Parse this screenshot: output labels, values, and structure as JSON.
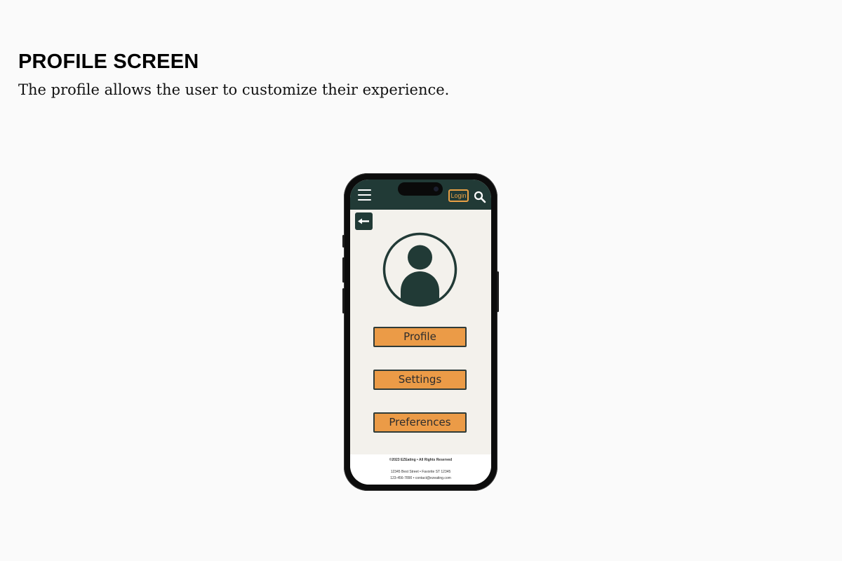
{
  "page": {
    "title": "PROFILE SCREEN",
    "description": "The profile allows the user to customize their experience."
  },
  "app": {
    "topbar": {
      "menu_icon": "hamburger-menu-icon",
      "login_label": "Login",
      "search_icon": "search-icon"
    },
    "back_icon": "arrow-left-icon",
    "avatar_icon": "user-avatar-icon",
    "buttons": [
      {
        "label": "Profile"
      },
      {
        "label": "Settings"
      },
      {
        "label": "Preferences"
      }
    ],
    "footer": {
      "copyright": "©2023 EZEating • All Rights Reserved",
      "address": "12345 Best Street • Favorite ST 12345",
      "contact": "123-456-7890 • contact@ezeating.com"
    }
  },
  "colors": {
    "primary_dark": "#213a36",
    "accent_orange": "#eb9b47",
    "login_orange": "#e8a045",
    "screen_background": "#f3f1ec",
    "page_background": "#fafafa"
  }
}
